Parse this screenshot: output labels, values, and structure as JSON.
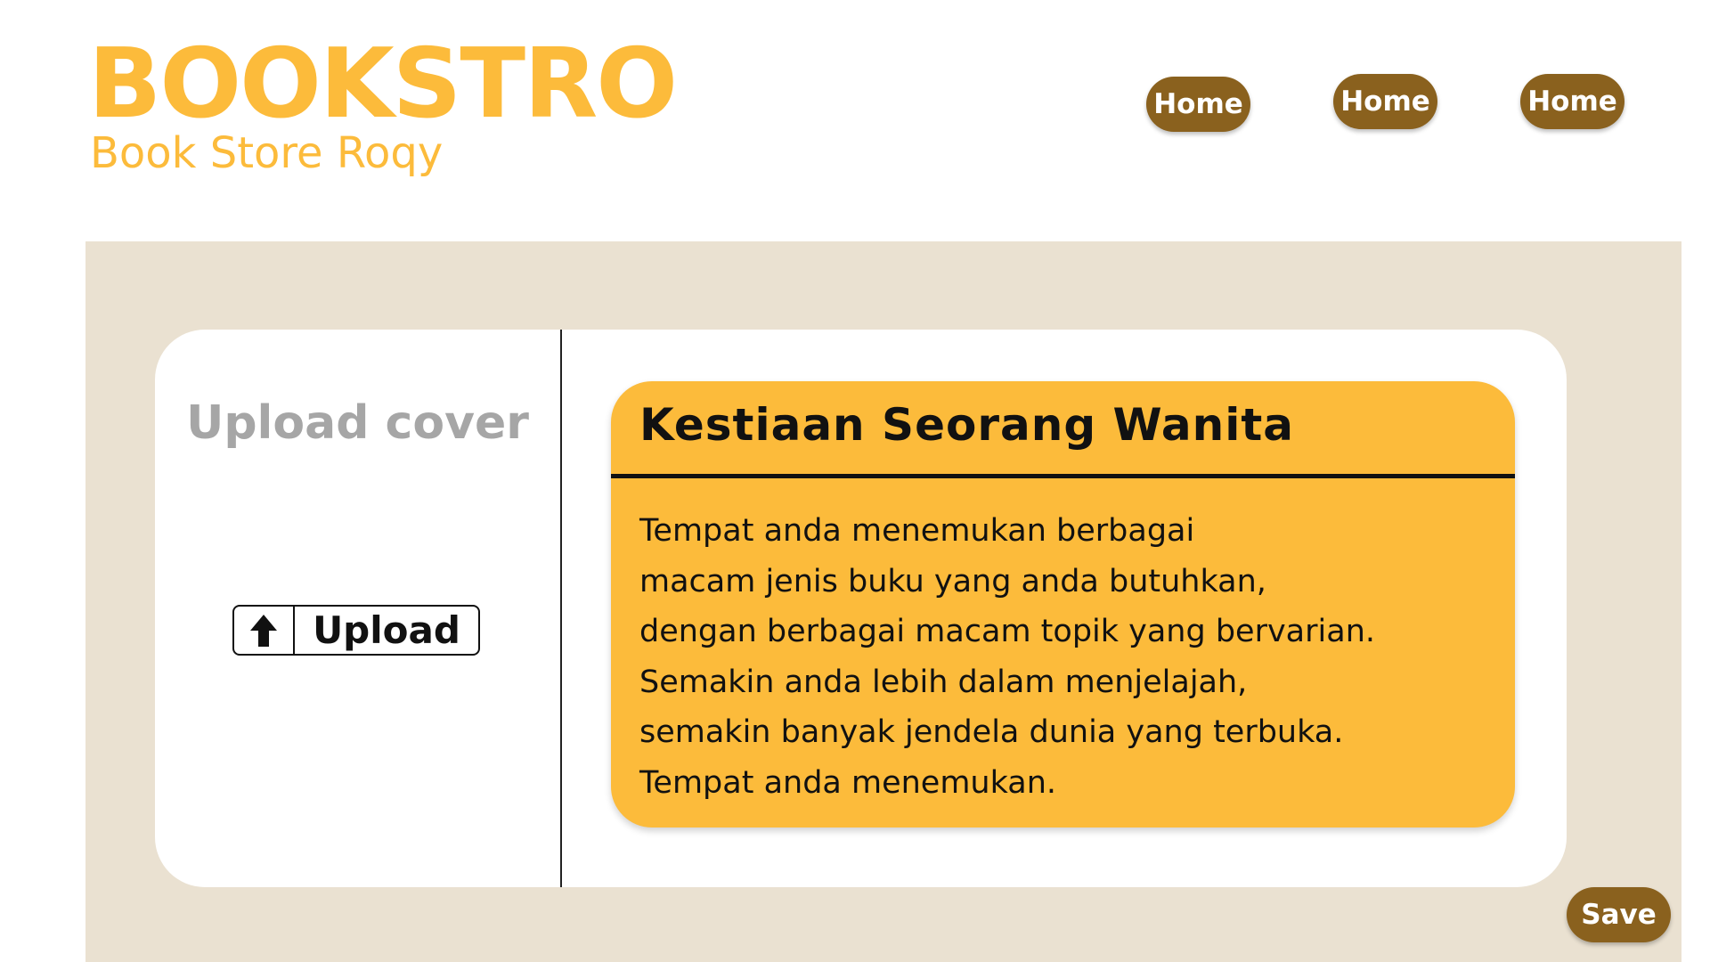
{
  "brand": {
    "title": "BOOKSTRO",
    "subtitle": "Book Store Roqy",
    "color": "#FCBB3B"
  },
  "nav": {
    "items": [
      {
        "label": "Home"
      },
      {
        "label": "Home"
      },
      {
        "label": "Home"
      }
    ],
    "button_color": "#8A611E"
  },
  "cover": {
    "heading": "Upload cover",
    "upload_button": {
      "label": "Upload",
      "icon": "arrow-up-icon"
    }
  },
  "book": {
    "title": "Kestiaan Seorang Wanita",
    "description_lines": [
      "Tempat anda menemukan berbagai",
      "macam jenis buku yang anda butuhkan,",
      "dengan berbagai macam topik yang bervarian.",
      "Semakin anda lebih dalam menjelajah,",
      "semakin banyak jendela dunia yang terbuka.",
      "Tempat anda menemukan."
    ],
    "card_color": "#FCBB3B"
  },
  "actions": {
    "save_label": "Save"
  },
  "colors": {
    "panel_bg": "#EAE1D1",
    "card_bg": "#FFFFFF",
    "muted_text": "#A6A6A6"
  }
}
